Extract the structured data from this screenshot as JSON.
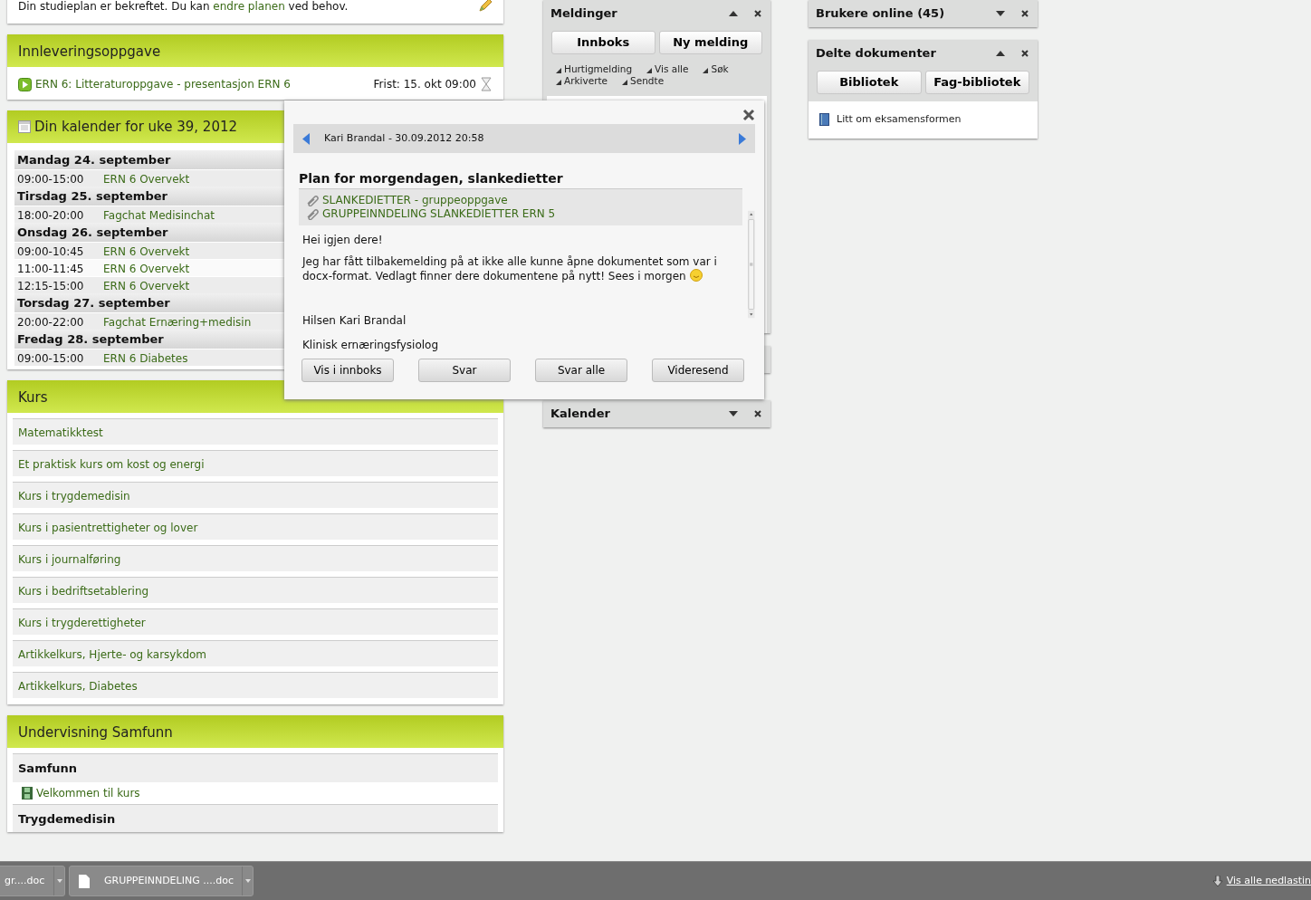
{
  "study_plan": {
    "text_before": "Din studieplan er bekreftet. Du kan",
    "link": "endre planen",
    "text_after": "ved behov."
  },
  "assignment": {
    "title": "Innleveringsoppgave",
    "items": [
      {
        "title": "ERN 6: Litteraturoppgave - presentasjon ERN 6",
        "deadline": "Frist: 15. okt 09:00"
      }
    ]
  },
  "calendar": {
    "title": "Din kalender for uke 39, 2012",
    "days": [
      {
        "day": "Mandag 24. september",
        "events": [
          {
            "time": "09:00-15:00",
            "title": "ERN 6 Overvekt",
            "highlighted": false
          }
        ]
      },
      {
        "day": "Tirsdag 25. september",
        "events": [
          {
            "time": "18:00-20:00",
            "title": "Fagchat Medisinchat",
            "highlighted": false
          }
        ]
      },
      {
        "day": "Onsdag 26. september",
        "events": [
          {
            "time": "09:00-10:45",
            "title": "ERN 6 Overvekt",
            "highlighted": false
          },
          {
            "time": "11:00-11:45",
            "title": "ERN 6 Overvekt",
            "highlighted": true
          },
          {
            "time": "12:15-15:00",
            "title": "ERN 6 Overvekt",
            "highlighted": false
          }
        ]
      },
      {
        "day": "Torsdag 27. september",
        "events": [
          {
            "time": "20:00-22:00",
            "title": "Fagchat Ernæring+medisin",
            "highlighted": false
          }
        ]
      },
      {
        "day": "Fredag 28. september",
        "events": [
          {
            "time": "09:00-15:00",
            "title": "ERN 6 Diabetes",
            "highlighted": false
          }
        ]
      }
    ]
  },
  "courses": {
    "title": "Kurs",
    "items": [
      "Matematikktest",
      "Et praktisk kurs om kost og energi",
      "Kurs i trygdemedisin",
      "Kurs i pasientrettigheter og lover",
      "Kurs i journalføring",
      "Kurs i bedriftsetablering",
      "Kurs i trygderettigheter",
      "Artikkelkurs, Hjerte- og karsykdom",
      "Artikkelkurs, Diabetes"
    ]
  },
  "teaching": {
    "title": "Undervisning Samfunn",
    "groups": [
      {
        "heading": "Samfunn",
        "items": [
          "Velkommen til kurs"
        ]
      },
      {
        "heading": "Trygdemedisin"
      }
    ]
  },
  "messages_widget": {
    "title": "Meldinger",
    "expanded": true,
    "buttons": [
      "Innboks",
      "Ny melding"
    ],
    "links": [
      "Hurtigmelding",
      "Vis alle",
      "Søk",
      "Arkiverte",
      "Sendte"
    ]
  },
  "calendar_widget": {
    "title": "Kalender",
    "expanded": false
  },
  "users_widget": {
    "title": "Brukere online (45)",
    "expanded": false
  },
  "documents_widget": {
    "title": "Delte dokumenter",
    "expanded": true,
    "buttons": [
      "Bibliotek",
      "Fag-bibliotek"
    ],
    "documents": [
      "Litt om eksamensformen"
    ]
  },
  "message_popup": {
    "header": "Kari Brandal - 30.09.2012 20:58",
    "subject": "Plan for morgendagen, slankedietter",
    "attachments": [
      "SLANKEDIETTER - gruppeoppgave",
      "GRUPPEINNDELING SLANKEDIETTER ERN 5"
    ],
    "paragraphs": [
      "Hei igjen dere!",
      "Jeg har fått tilbakemelding på at ikke alle kunne åpne dokumentet som var i docx-format. Vedlagt finner dere dokumentene på nytt!  Sees i morgen"
    ],
    "signature": [
      "Hilsen Kari Brandal",
      "Klinisk ernæringsfysiolog"
    ],
    "buttons": [
      "Vis i innboks",
      "Svar",
      "Svar alle",
      "Videresend"
    ]
  },
  "downloads_bar": {
    "items": [
      "gr....doc",
      "GRUPPEINNDELING ....doc"
    ],
    "link": "Vis alle nedlastin"
  }
}
